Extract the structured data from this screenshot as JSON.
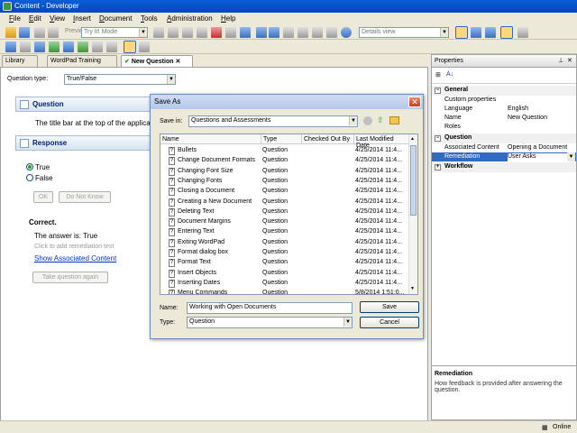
{
  "window": {
    "title": "Content - Developer"
  },
  "menu": [
    "File",
    "Edit",
    "View",
    "Insert",
    "Document",
    "Tools",
    "Administration",
    "Help"
  ],
  "toolbar": {
    "preview_label": "Preview",
    "mode_value": "Try It! Mode",
    "view_value": "Details view"
  },
  "tabs": [
    {
      "label": "Library"
    },
    {
      "label": "WordPad Training"
    },
    {
      "label": "New Question"
    }
  ],
  "editor": {
    "question_type_label": "Question type:",
    "question_type_value": "True/False",
    "question_header": "Question",
    "question_text": "The title bar at the top of the applica",
    "response_header": "Response",
    "option_true": "True",
    "option_false": "False",
    "ok_label": "OK",
    "do_not_know_label": "Do Not Know",
    "correct_label": "Correct.",
    "answer_text": "The answer is: True",
    "remediation_hint": "Click to add remediation text",
    "show_content_link": "Show Associated Content",
    "take_again_label": "Take question again"
  },
  "properties": {
    "title": "Properties",
    "groups": {
      "general": "General",
      "question": "Question",
      "workflow": "Workflow"
    },
    "general_rows": [
      {
        "key": "Custom properties",
        "value": ""
      },
      {
        "key": "Language",
        "value": "English"
      },
      {
        "key": "Name",
        "value": "New Question"
      },
      {
        "key": "Roles",
        "value": ""
      }
    ],
    "question_rows": [
      {
        "key": "Associated Content",
        "value": "Opening a Document"
      },
      {
        "key": "Remediation",
        "value": "User Asks"
      }
    ],
    "help_title": "Remediation",
    "help_text": "How feedback is provided after answering the question."
  },
  "status": {
    "online": "Online"
  },
  "dialog": {
    "title": "Save As",
    "save_in_label": "Save in:",
    "save_in_value": "Questions and Assessments",
    "columns": [
      "Name",
      "Type",
      "Checked Out By",
      "Last Modified Date"
    ],
    "files": [
      {
        "name": "Bullets",
        "type": "Question",
        "date": "4/25/2014 11:4..."
      },
      {
        "name": "Change Document Formats",
        "type": "Question",
        "date": "4/25/2014 11:4..."
      },
      {
        "name": "Changing Font Size",
        "type": "Question",
        "date": "4/25/2014 11:4..."
      },
      {
        "name": "Changing Fonts",
        "type": "Question",
        "date": "4/25/2014 11:4..."
      },
      {
        "name": "Closing a Document",
        "type": "Question",
        "date": "4/25/2014 11:4..."
      },
      {
        "name": "Creating a New Document",
        "type": "Question",
        "date": "4/25/2014 11:4..."
      },
      {
        "name": "Deleting Text",
        "type": "Question",
        "date": "4/25/2014 11:4..."
      },
      {
        "name": "Document Margins",
        "type": "Question",
        "date": "4/25/2014 11:4..."
      },
      {
        "name": "Entering Text",
        "type": "Question",
        "date": "4/25/2014 11:4..."
      },
      {
        "name": "Exiting WordPad",
        "type": "Question",
        "date": "4/25/2014 11:4..."
      },
      {
        "name": "Format dialog box",
        "type": "Question",
        "date": "4/25/2014 11:4..."
      },
      {
        "name": "Format Text",
        "type": "Question",
        "date": "4/25/2014 11:4..."
      },
      {
        "name": "Insert Objects",
        "type": "Question",
        "date": "4/25/2014 11:4..."
      },
      {
        "name": "Inserting Dates",
        "type": "Question",
        "date": "4/25/2014 11:4..."
      },
      {
        "name": "Menu Commands",
        "type": "Question",
        "date": "5/8/2014 1:51:0..."
      }
    ],
    "name_label": "Name:",
    "name_value": "Working with Open Documents",
    "type_label": "Type:",
    "type_value": "Question",
    "save_label": "Save",
    "cancel_label": "Cancel"
  }
}
